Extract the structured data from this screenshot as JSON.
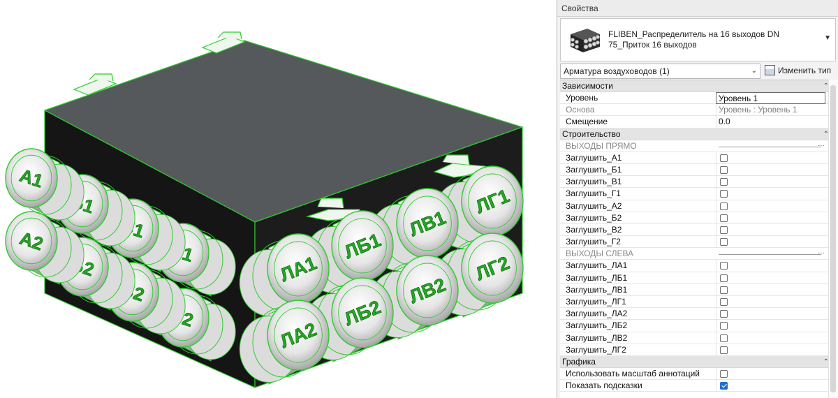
{
  "viewport": {
    "label_color": "#22a822",
    "front_outlets": [
      "А1",
      "Б1",
      "В1",
      "Г1",
      "А2",
      "Б2",
      "В2",
      "Г2"
    ],
    "side_outlets": [
      "ЛА1",
      "ЛБ1",
      "ЛВ1",
      "ЛГ1",
      "ЛА2",
      "ЛБ2",
      "ЛВ2",
      "ЛГ2"
    ]
  },
  "properties": {
    "title": "Свойства",
    "type_selector": {
      "name": "FLIBEN_Распределитель на 16 выходов DN 75_Приток 16 выходов",
      "icon": "distributor-thumbnail-icon"
    },
    "instance_filter": "Арматура воздуховодов (1)",
    "edit_type_label": "Изменить тип",
    "sections": {
      "constraints": {
        "title": "Зависимости",
        "level_label": "Уровень",
        "level_value": "Уровень 1",
        "base_label": "Основа",
        "base_value": "Уровень : Уровень 1",
        "offset_label": "Смещение",
        "offset_value": "0.0"
      },
      "construction": {
        "title": "Строительство",
        "group_straight": "ВЫХОДЫ ПРЯМО",
        "straight": [
          {
            "label": "Заглушить_А1",
            "checked": false
          },
          {
            "label": "Заглушить_Б1",
            "checked": false
          },
          {
            "label": "Заглушить_В1",
            "checked": false
          },
          {
            "label": "Заглушить_Г1",
            "checked": false
          },
          {
            "label": "Заглушить_А2",
            "checked": false
          },
          {
            "label": "Заглушить_Б2",
            "checked": false
          },
          {
            "label": "Заглушить_В2",
            "checked": false
          },
          {
            "label": "Заглушить_Г2",
            "checked": false
          }
        ],
        "group_left": "ВЫХОДЫ СЛЕВА",
        "left": [
          {
            "label": "Заглушить_ЛА1",
            "checked": false
          },
          {
            "label": "Заглушить_ЛБ1",
            "checked": false
          },
          {
            "label": "Заглушить_ЛВ1",
            "checked": false
          },
          {
            "label": "Заглушить_ЛГ1",
            "checked": false
          },
          {
            "label": "Заглушить_ЛА2",
            "checked": false
          },
          {
            "label": "Заглушить_ЛБ2",
            "checked": false
          },
          {
            "label": "Заглушить_ЛВ2",
            "checked": false
          },
          {
            "label": "Заглушить_ЛГ2",
            "checked": false
          }
        ]
      },
      "graphics": {
        "title": "Графика",
        "annot_scale_label": "Использовать масштаб аннотаций",
        "annot_scale_checked": false,
        "show_hints_label": "Показать подсказки",
        "show_hints_checked": true
      }
    }
  }
}
